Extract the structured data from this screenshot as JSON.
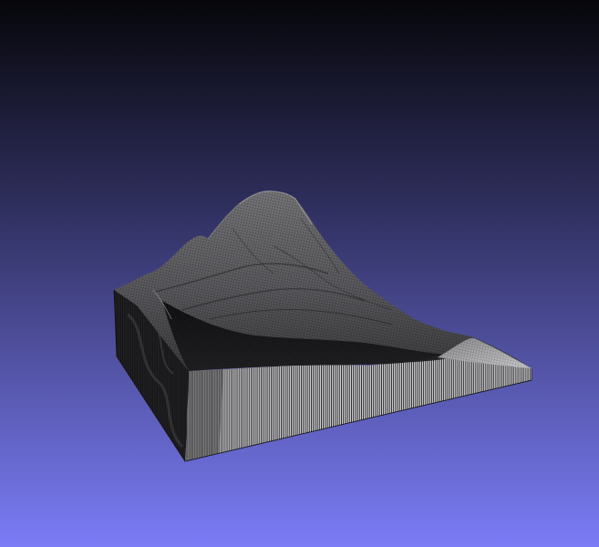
{
  "viewer": {
    "background_top_color": "#06060a",
    "background_bottom_color": "#7b7cf6",
    "mesh_top_color": "#5e5e62",
    "mesh_shadow_color": "#141416",
    "wall_light_color": "#a8a8aa",
    "wall_dark_color": "#1a1a1a",
    "wireframe_color": "#000000",
    "render_mode": "wireframe-over-flat"
  }
}
